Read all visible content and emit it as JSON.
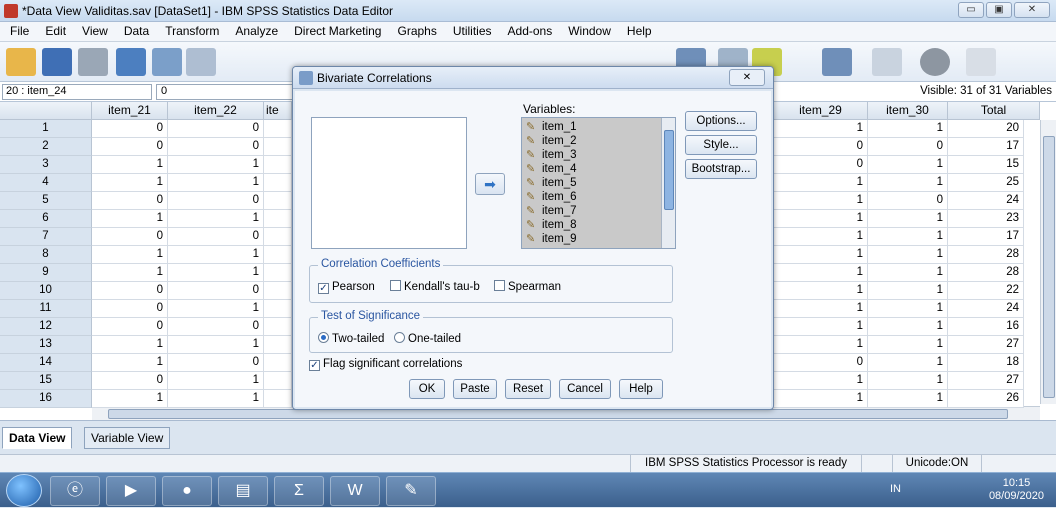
{
  "window": {
    "title": "*Data View Validitas.sav [DataSet1] - IBM SPSS Statistics Data Editor",
    "minimize": "▭",
    "restore": "▣",
    "close": "✕"
  },
  "menu": [
    "File",
    "Edit",
    "View",
    "Data",
    "Transform",
    "Analyze",
    "Direct Marketing",
    "Graphs",
    "Utilities",
    "Add-ons",
    "Window",
    "Help"
  ],
  "cell_ref": {
    "ref": "20 : item_24",
    "value": "0",
    "visible": "Visible: 31 of 31 Variables"
  },
  "grid": {
    "left_columns": [
      "item_21",
      "item_22",
      "ite"
    ],
    "right_columns": [
      "item_29",
      "item_30",
      "Total"
    ],
    "rows": [
      {
        "n": "1",
        "a": "0",
        "b": "0",
        "c": "1",
        "d": "1",
        "t": "20"
      },
      {
        "n": "2",
        "a": "0",
        "b": "0",
        "c": "0",
        "d": "0",
        "t": "17"
      },
      {
        "n": "3",
        "a": "1",
        "b": "1",
        "c": "0",
        "d": "1",
        "t": "15"
      },
      {
        "n": "4",
        "a": "1",
        "b": "1",
        "c": "1",
        "d": "1",
        "t": "25"
      },
      {
        "n": "5",
        "a": "0",
        "b": "0",
        "c": "1",
        "d": "0",
        "t": "24"
      },
      {
        "n": "6",
        "a": "1",
        "b": "1",
        "c": "1",
        "d": "1",
        "t": "23"
      },
      {
        "n": "7",
        "a": "0",
        "b": "0",
        "c": "1",
        "d": "1",
        "t": "17"
      },
      {
        "n": "8",
        "a": "1",
        "b": "1",
        "c": "1",
        "d": "1",
        "t": "28"
      },
      {
        "n": "9",
        "a": "1",
        "b": "1",
        "c": "1",
        "d": "1",
        "t": "28"
      },
      {
        "n": "10",
        "a": "0",
        "b": "0",
        "c": "1",
        "d": "1",
        "t": "22"
      },
      {
        "n": "11",
        "a": "0",
        "b": "1",
        "c": "1",
        "d": "1",
        "t": "24"
      },
      {
        "n": "12",
        "a": "0",
        "b": "0",
        "c": "1",
        "d": "1",
        "t": "16"
      },
      {
        "n": "13",
        "a": "1",
        "b": "1",
        "c": "1",
        "d": "1",
        "t": "27"
      },
      {
        "n": "14",
        "a": "1",
        "b": "0",
        "c": "0",
        "d": "1",
        "t": "18"
      },
      {
        "n": "15",
        "a": "0",
        "b": "1",
        "c": "1",
        "d": "1",
        "t": "27"
      },
      {
        "n": "16",
        "a": "1",
        "b": "1",
        "c": "1",
        "d": "1",
        "t": "26"
      }
    ]
  },
  "dialog": {
    "title": "Bivariate Correlations",
    "close": "✕",
    "variables_label": "Variables:",
    "variables": [
      "item_1",
      "item_2",
      "item_3",
      "item_4",
      "item_5",
      "item_6",
      "item_7",
      "item_8",
      "item_9"
    ],
    "side_buttons": [
      "Options...",
      "Style...",
      "Bootstrap..."
    ],
    "coeff_title": "Correlation Coefficients",
    "pearson": "Pearson",
    "kendall": "Kendall's tau-b",
    "spearman": "Spearman",
    "sig_title": "Test of Significance",
    "two_tailed": "Two-tailed",
    "one_tailed": "One-tailed",
    "flag": "Flag significant correlations",
    "buttons": [
      "OK",
      "Paste",
      "Reset",
      "Cancel",
      "Help"
    ],
    "check_mark": "✓",
    "arrow": "➡"
  },
  "tabs": {
    "data_view": "Data View",
    "variable_view": "Variable View"
  },
  "status": {
    "processor": "IBM SPSS Statistics Processor is ready",
    "unicode": "Unicode:ON"
  },
  "taskbar": {
    "lang": "IN",
    "time": "10:15",
    "date": "08/09/2020"
  },
  "colors": {
    "selection": "#c9c9c9",
    "accent": "#2a6bc5"
  }
}
